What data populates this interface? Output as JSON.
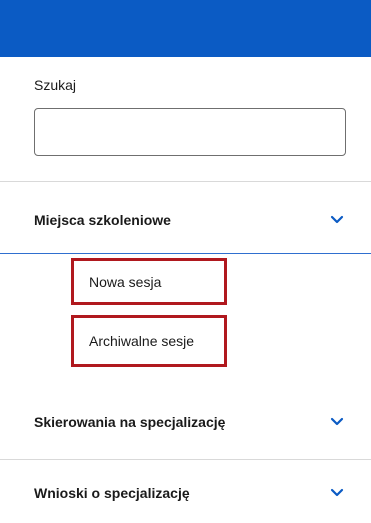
{
  "search": {
    "label": "Szukaj",
    "value": "",
    "placeholder": ""
  },
  "nav": {
    "sections": [
      {
        "title": "Miejsca szkoleniowe",
        "expanded": true,
        "chevron": "chevron-down-icon"
      },
      {
        "title": "Skierowania na specjalizację",
        "expanded": false,
        "chevron": "chevron-down-icon"
      },
      {
        "title": "Wnioski o specjalizację",
        "expanded": false,
        "chevron": "chevron-down-icon"
      }
    ],
    "sub_items": [
      {
        "label": "Nowa sesja"
      },
      {
        "label": "Archiwalne sesje"
      }
    ]
  },
  "colors": {
    "header": "#0b5bc4",
    "accent": "#0b5bc4",
    "highlight_border": "#b0181e"
  }
}
